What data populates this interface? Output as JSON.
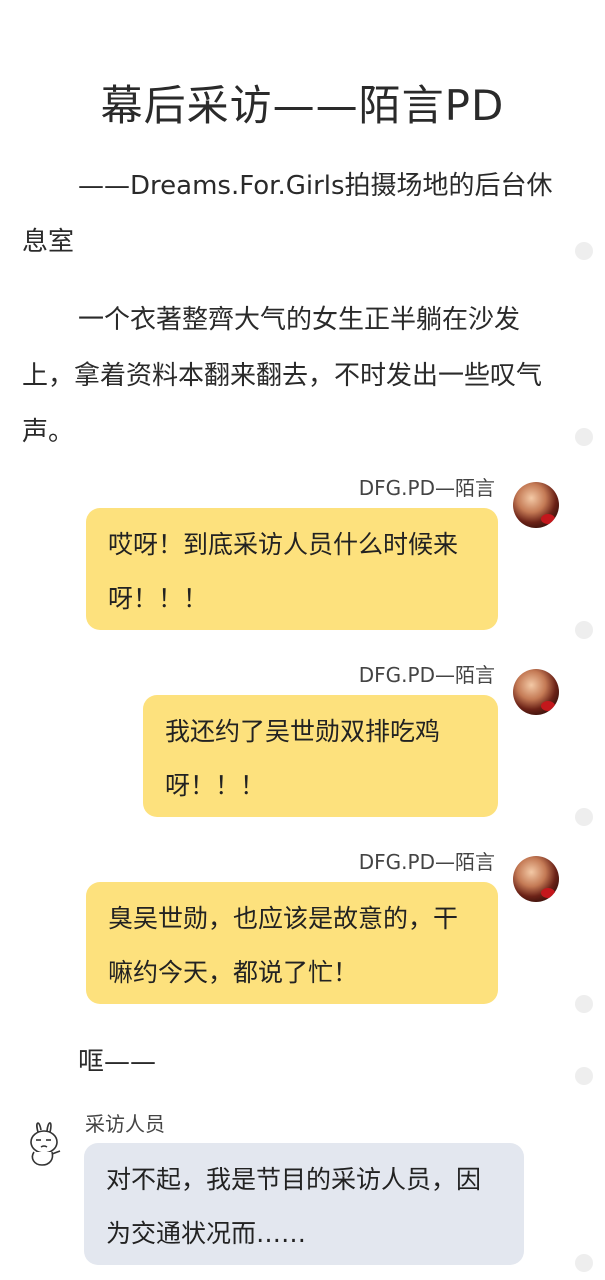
{
  "article": {
    "title": "幕后采访——陌言PD",
    "para1": "——Dreams.For.Girls拍摄场地的后台休息室",
    "para2": "一个衣著整齊大气的女生正半躺在沙发上，拿着资料本翻来翻去，不时发出一些叹气声。",
    "sound": "哐——"
  },
  "messages": [
    {
      "sender": "DFG.PD—陌言",
      "text": "哎呀！到底采访人员什么时候来呀！！！",
      "side": "right",
      "color": "#fde17d"
    },
    {
      "sender": "DFG.PD—陌言",
      "text": "我还约了吴世勋双排吃鸡呀！！！",
      "side": "right",
      "color": "#fde17d"
    },
    {
      "sender": "DFG.PD—陌言",
      "text": "臭吴世勋，也应该是故意的，干嘛约今天，都说了忙！",
      "side": "right",
      "color": "#fde17d"
    },
    {
      "sender": "采访人员",
      "text": "对不起，我是节目的采访人员，因为交通状况而……",
      "side": "left",
      "color": "#e3e7ef"
    }
  ],
  "icons": {
    "right_avatar": "avatar-photo",
    "left_avatar": "rabbit-sticker-icon"
  }
}
